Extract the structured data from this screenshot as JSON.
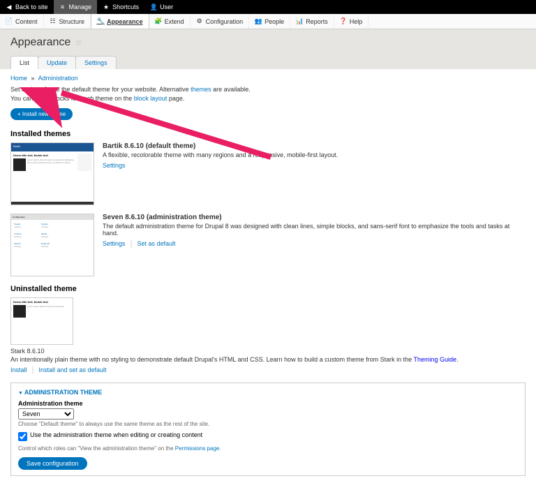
{
  "toolbar": {
    "back": "Back to site",
    "manage": "Manage",
    "shortcuts": "Shortcuts",
    "user": "User"
  },
  "admin_menu": {
    "content": "Content",
    "structure": "Structure",
    "appearance": "Appearance",
    "extend": "Extend",
    "configuration": "Configuration",
    "people": "People",
    "reports": "Reports",
    "help": "Help"
  },
  "page": {
    "title": "Appearance"
  },
  "tabs": {
    "list": "List",
    "update": "Update",
    "settings": "Settings"
  },
  "breadcrumb": {
    "home": "Home",
    "admin": "Administration"
  },
  "intro": {
    "line1a": "Set and configure the default theme for your website. Alternative ",
    "line1b": "themes",
    "line1c": " are available.",
    "line2a": "You can place blocks for each theme on the ",
    "line2b": "block layout",
    "line2c": " page."
  },
  "install_btn": "+ Install new theme",
  "installed_heading": "Installed themes",
  "themes": {
    "bartik": {
      "name": "Bartik 8.6.10 (default theme)",
      "desc": "A flexible, recolorable theme with many regions and a responsive, mobile-first layout.",
      "settings": "Settings"
    },
    "seven": {
      "name": "Seven 8.6.10 (administration theme)",
      "desc": "The default administration theme for Drupal 8 was designed with clean lines, simple blocks, and sans-serif font to emphasize the tools and tasks at hand.",
      "settings": "Settings",
      "default": "Set as default"
    }
  },
  "uninstalled_heading": "Uninstalled theme",
  "stark": {
    "name": "Stark 8.6.10",
    "desc1": "An intentionally plain theme with no styling to demonstrate default Drupal's HTML and CSS. Learn how to build a custom theme from Stark in the ",
    "desc_link": "Theming Guide",
    "install": "Install",
    "install_default": "Install and set as default"
  },
  "admin_theme": {
    "legend": "ADMINISTRATION THEME",
    "label": "Administration theme",
    "selected": "Seven",
    "help1": "Choose \"Default theme\" to always use the same theme as the rest of the site.",
    "checkbox": "Use the administration theme when editing or creating content",
    "help2a": "Control which roles can \"View the administration theme\" on the ",
    "help2b": "Permissions page",
    "save": "Save configuration"
  }
}
